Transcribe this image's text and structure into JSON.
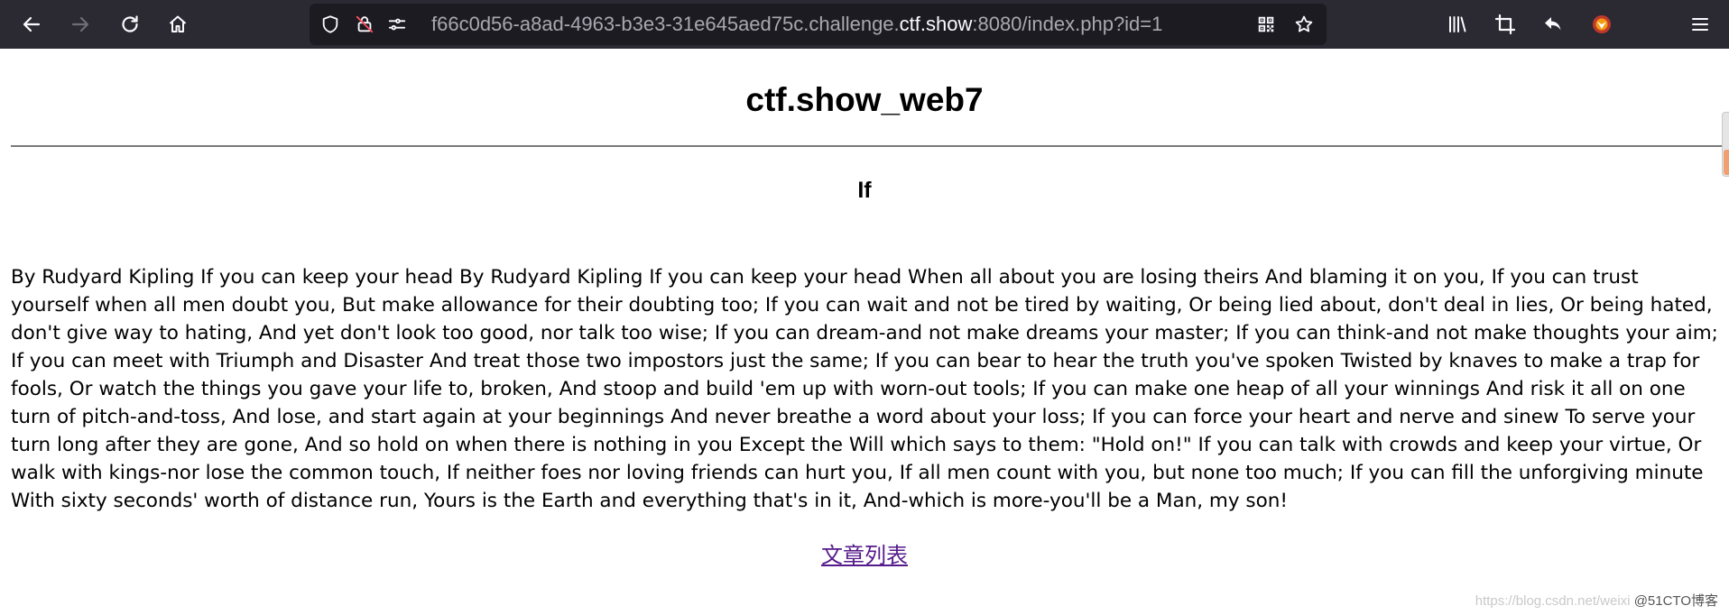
{
  "browser": {
    "url_prefix": "f66c0d56-a8ad-4963-b3e3-31e645aed75c.challenge.",
    "url_host": "ctf.show",
    "url_suffix": ":8080/index.php?id=1",
    "icons": {
      "back": "arrow-left-icon",
      "forward": "arrow-right-icon",
      "reload": "reload-icon",
      "home": "home-icon",
      "shield": "shield-icon",
      "permissions": "camera-blocked-icon",
      "site_info": "sliders-icon",
      "qr": "qr-code-icon",
      "bookmark": "star-icon",
      "library": "library-icon",
      "crop": "crop-icon",
      "undo": "undo-icon",
      "avatar": "avatar-icon",
      "menu": "hamburger-menu-icon"
    },
    "colors": {
      "toolbar_bg": "#2b2a33",
      "urlbar_bg": "#1c1b22",
      "url_dim": "#a9a8b0",
      "url_strong": "#fbfbfe"
    }
  },
  "page": {
    "title": "ctf.show_web7",
    "article_title": "If",
    "article_body": "By Rudyard Kipling If you can keep your head By Rudyard Kipling If you can keep your head When all about you are losing theirs And blaming it on you, If you can trust yourself when all men doubt you, But make allowance for their doubting too; If you can wait and not be tired by waiting, Or being lied about, don't deal in lies, Or being hated, don't give way to hating, And yet don't look too good, nor talk too wise; If you can dream-and not make dreams your master; If you can think-and not make thoughts your aim; If you can meet with Triumph and Disaster And treat those two impostors just the same; If you can bear to hear the truth you've spoken Twisted by knaves to make a trap for fools, Or watch the things you gave your life to, broken, And stoop and build 'em up with worn-out tools; If you can make one heap of all your winnings And risk it all on one turn of pitch-and-toss, And lose, and start again at your beginnings And never breathe a word about your loss; If you can force your heart and nerve and sinew To serve your turn long after they are gone, And so hold on when there is nothing in you Except the Will which says to them: \"Hold on!\" If you can talk with crowds and keep your virtue, Or walk with kings-nor lose the common touch, If neither foes nor loving friends can hurt you, If all men count with you, but none too much; If you can fill the unforgiving minute With sixty seconds' worth of distance run, Yours is the Earth and everything that's in it, And-which is more-you'll be a Man, my son!",
    "list_link": "文章列表",
    "link_color": "#551a8b"
  },
  "watermark": {
    "text_dim": "https://blog.csdn.net/weixi",
    "text_strong": "@51CTO博客"
  }
}
